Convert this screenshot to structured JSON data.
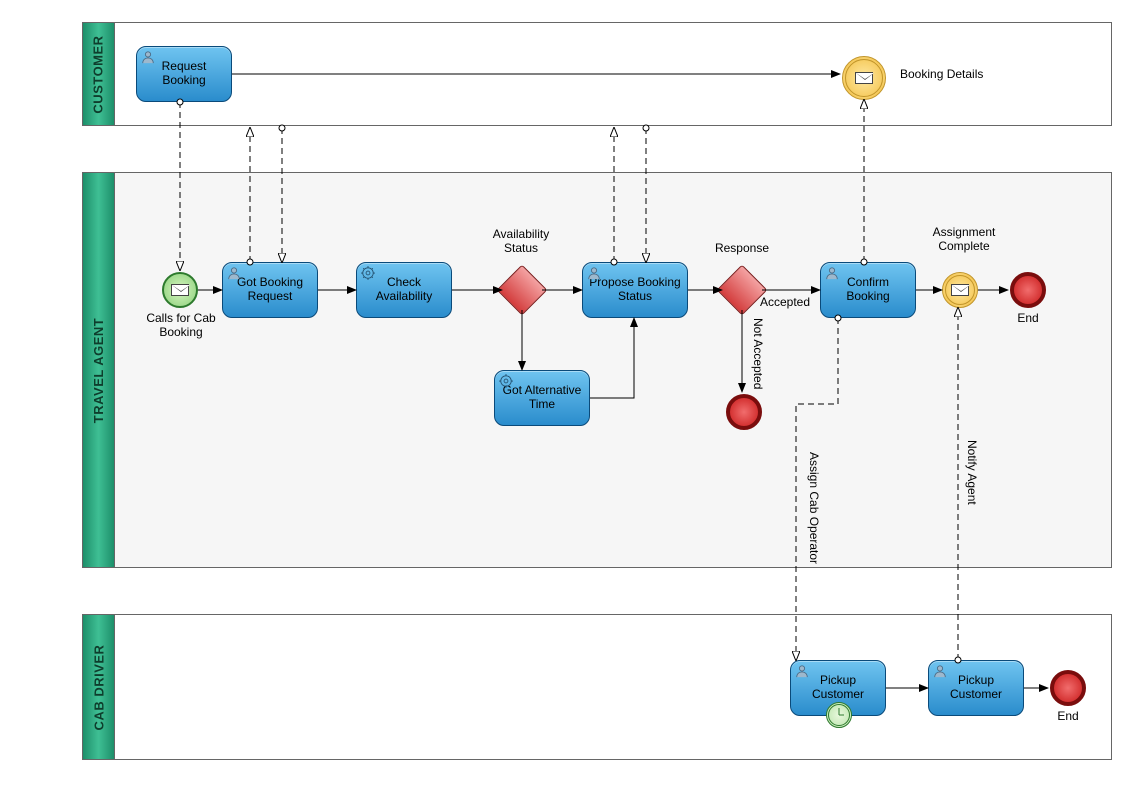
{
  "pools": {
    "customer": {
      "label": "CUSTOMER"
    },
    "travel_agent": {
      "label": "TRAVEL AGENT"
    },
    "cab_driver": {
      "label": "CAB DRIVER"
    }
  },
  "tasks": {
    "request_booking": "Request Booking",
    "got_booking_request": "Got Booking Request",
    "check_availability": "Check Availability",
    "got_alternative_time": "Got Alternative Time",
    "propose_booking_status": "Propose Booking Status",
    "confirm_booking": "Confirm Booking",
    "pickup_customer_1": "Pickup Customer",
    "pickup_customer_2": "Pickup Customer"
  },
  "events": {
    "calls_for_cab_booking": "Calls for Cab Booking",
    "booking_details": "Booking Details",
    "assignment_complete": "Assignment Complete",
    "end_agent": "End",
    "end_driver": "End"
  },
  "gateways": {
    "availability_status": "Availability Status",
    "response": "Response"
  },
  "labels": {
    "accepted": "Accepted",
    "not_accepted": "Not Accepted",
    "assign_cab_operator": "Assign Cab Operator",
    "notify_agent": "Notify Agent"
  }
}
